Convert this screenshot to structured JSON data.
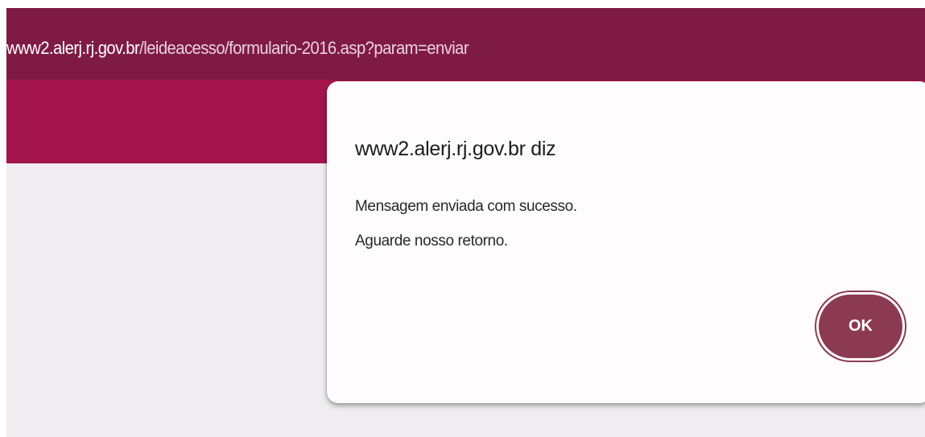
{
  "address_bar": {
    "host": "www2.alerj.rj.gov.br",
    "path": "/leideacesso/formulario-2016.asp?param=enviar"
  },
  "dialog": {
    "title": "www2.alerj.rj.gov.br diz",
    "message_lines": [
      "Mensagem enviada com sucesso.",
      "Aguarde nosso retorno."
    ],
    "ok_label": "OK"
  },
  "colors": {
    "address_bar_bg": "#7f1a45",
    "site_header_bg": "#a5154d",
    "page_bg": "#efedf0",
    "dialog_bg": "#fefcfd",
    "ok_button_bg": "#8b3a52"
  }
}
